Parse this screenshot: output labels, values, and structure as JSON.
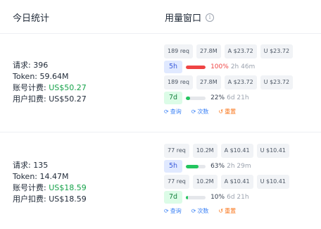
{
  "header": {
    "stats_title": "今日统计",
    "usage_title": "用量窗口",
    "info_icon": "i"
  },
  "rows": [
    {
      "stats": {
        "requests": "请求: 396",
        "tokens": "Token: 59.64M",
        "account_label": "账号计费: ",
        "account_value": "US$50.27",
        "user_label": "用户扣费: ",
        "user_value": "US$50.27"
      },
      "windows": [
        {
          "chips": [
            "189 req",
            "27.8M",
            "A $23.72",
            "U $23.72"
          ],
          "badge": "5h",
          "fill_percent": 100,
          "fill_color": "#ef4444",
          "percent_text": "100%",
          "percent_color": "red",
          "remaining": "2h 46m"
        },
        {
          "chips": [
            "189 req",
            "27.8M",
            "A $23.72",
            "U $23.72"
          ],
          "badge": "7d",
          "fill_percent": 22,
          "fill_color": "#22c55e",
          "percent_text": "22%",
          "percent_color": "normal",
          "remaining": "6d 21h"
        }
      ],
      "actions": {
        "query": "查询",
        "count": "次数",
        "reset": "重置"
      }
    },
    {
      "stats": {
        "requests": "请求: 135",
        "tokens": "Token: 14.47M",
        "account_label": "账号计费: ",
        "account_value": "US$18.59",
        "user_label": "用户扣费: ",
        "user_value": "US$18.59"
      },
      "windows": [
        {
          "chips": [
            "77 req",
            "10.2M",
            "A $10.41",
            "U $10.41"
          ],
          "badge": "5h",
          "fill_percent": 63,
          "fill_color": "#22c55e",
          "percent_text": "63%",
          "percent_color": "normal",
          "remaining": "2h 29m"
        },
        {
          "chips": [
            "77 req",
            "10.2M",
            "A $10.41",
            "U $10.41"
          ],
          "badge": "7d",
          "fill_percent": 10,
          "fill_color": "#22c55e",
          "percent_text": "10%",
          "percent_color": "normal",
          "remaining": "6d 21h"
        }
      ],
      "actions": {
        "query": "查询",
        "count": "次数",
        "reset": "重置"
      }
    }
  ],
  "icons": {
    "refresh": "refresh-icon",
    "reset": "reset-icon",
    "info": "info-icon"
  }
}
